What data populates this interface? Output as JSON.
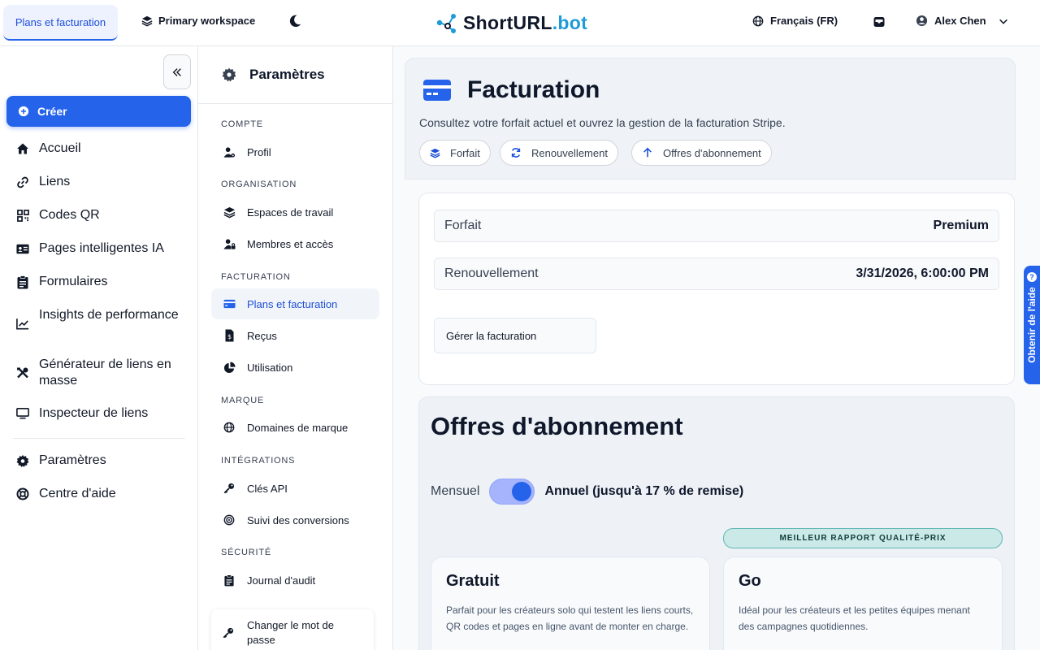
{
  "topbar": {
    "active_tab": "Plans et facturation",
    "workspace": "Primary workspace",
    "logo_main": "ShortURL",
    "logo_dot": ".bot",
    "language": "Français (FR)",
    "user_name": "Alex Chen"
  },
  "sidebar": {
    "create_label": "Créer",
    "items": [
      {
        "label": "Accueil",
        "icon": "home-icon"
      },
      {
        "label": "Liens",
        "icon": "link-icon"
      },
      {
        "label": "Codes QR",
        "icon": "qr-icon"
      },
      {
        "label": "Pages intelligentes IA",
        "icon": "id-card-icon"
      },
      {
        "label": "Formulaires",
        "icon": "clipboard-icon"
      },
      {
        "label": "Insights de performance",
        "icon": "chart-line-icon"
      },
      {
        "label": "Générateur de liens en masse",
        "icon": "tools-icon"
      },
      {
        "label": "Inspecteur de liens",
        "icon": "monitor-icon"
      }
    ],
    "bottom_items": [
      {
        "label": "Paramètres",
        "icon": "gear-icon"
      },
      {
        "label": "Centre d'aide",
        "icon": "lifebuoy-icon"
      }
    ]
  },
  "settings": {
    "title": "Paramètres",
    "sections": {
      "compte": "COMPTE",
      "organisation": "ORGANISATION",
      "facturation": "FACTURATION",
      "marque": "MARQUE",
      "integrations": "INTÉGRATIONS",
      "securite": "SÉCURITÉ"
    },
    "items": {
      "profil": "Profil",
      "espaces": "Espaces de travail",
      "membres": "Membres et accès",
      "plans": "Plans et facturation",
      "recus": "Reçus",
      "utilisation": "Utilisation",
      "domaines": "Domaines de marque",
      "cles": "Clés API",
      "suivi": "Suivi des conversions",
      "journal": "Journal d'audit",
      "password": "Changer le mot de passe"
    }
  },
  "billing": {
    "title": "Facturation",
    "subtitle": "Consultez votre forfait actuel et ouvrez la gestion de la facturation Stripe.",
    "pills": [
      "Forfait",
      "Renouvellement",
      "Offres d'abonnement"
    ],
    "rows": [
      {
        "label": "Forfait",
        "value": "Premium"
      },
      {
        "label": "Renouvellement",
        "value": "3/31/2026, 6:00:00 PM"
      }
    ],
    "manage_label": "Gérer la facturation"
  },
  "offers": {
    "title": "Offres d'abonnement",
    "monthly": "Mensuel",
    "annual": "Annuel (jusqu'à 17 % de remise)",
    "annual_selected": true,
    "badge": "MEILLEUR RAPPORT QUALITÉ-PRIX",
    "plans": [
      {
        "name": "Gratuit",
        "desc": "Parfait pour les créateurs solo qui testent les liens courts, QR codes et pages en ligne avant de monter en charge."
      },
      {
        "name": "Go",
        "desc": "Idéal pour les créateurs et les petites équipes menant des campagnes quotidiennes."
      }
    ]
  },
  "help_tab": "Obtenir de l'aide",
  "colors": {
    "accent": "#2563eb",
    "badge_bg": "#cbe9e7",
    "logo_dot": "#1e9bd7"
  }
}
